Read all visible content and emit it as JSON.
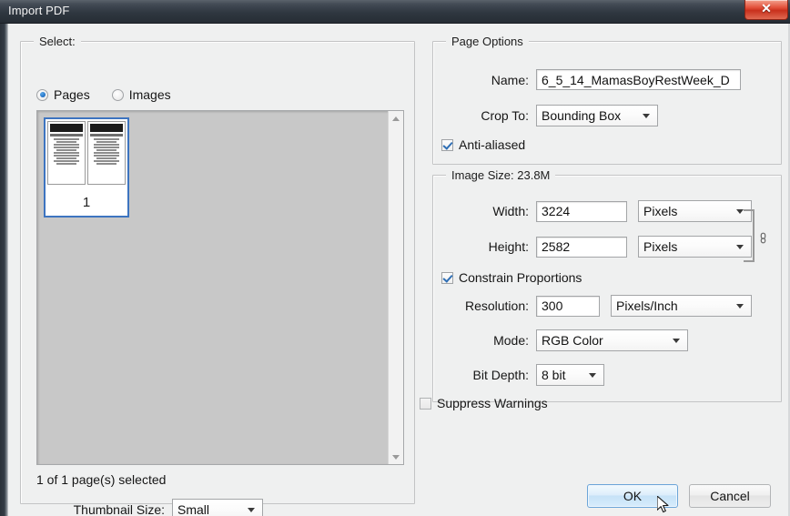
{
  "window": {
    "title": "Import PDF",
    "close_label": "✕"
  },
  "select_group": {
    "title": "Select:",
    "radios": [
      {
        "label": "Pages",
        "selected": true
      },
      {
        "label": "Images",
        "selected": false
      }
    ],
    "thumbnail": {
      "page_number": "1",
      "selected": true
    },
    "status": "1 of 1 page(s) selected",
    "thumbnail_size": {
      "label": "Thumbnail Size:",
      "value": "Small"
    },
    "scrollbar": {
      "up_icon": "triangle-up-icon",
      "down_icon": "triangle-down-icon"
    }
  },
  "page_options": {
    "title": "Page Options",
    "name": {
      "label": "Name:",
      "value": "6_5_14_MamasBoyRestWeek_D"
    },
    "crop_to": {
      "label": "Crop To:",
      "value": "Bounding Box"
    },
    "anti_aliased": {
      "label": "Anti-aliased",
      "checked": true
    }
  },
  "image_size": {
    "title": "Image Size: 23.8M",
    "width": {
      "label": "Width:",
      "value": "3224",
      "unit": "Pixels"
    },
    "height": {
      "label": "Height:",
      "value": "2582",
      "unit": "Pixels"
    },
    "constrain_proportions": {
      "label": "Constrain Proportions",
      "checked": true
    },
    "resolution": {
      "label": "Resolution:",
      "value": "300",
      "unit": "Pixels/Inch"
    },
    "mode": {
      "label": "Mode:",
      "value": "RGB Color"
    },
    "bit_depth": {
      "label": "Bit Depth:",
      "value": "8 bit"
    },
    "link_icon": "chain-link-icon"
  },
  "suppress_warnings": {
    "label": "Suppress Warnings",
    "checked": false
  },
  "buttons": {
    "ok": "OK",
    "cancel": "Cancel"
  },
  "colors": {
    "accent": "#1f6fc4",
    "titlebar": "#2f3740",
    "close": "#c9301c",
    "dialog_bg": "#eff0f0"
  }
}
